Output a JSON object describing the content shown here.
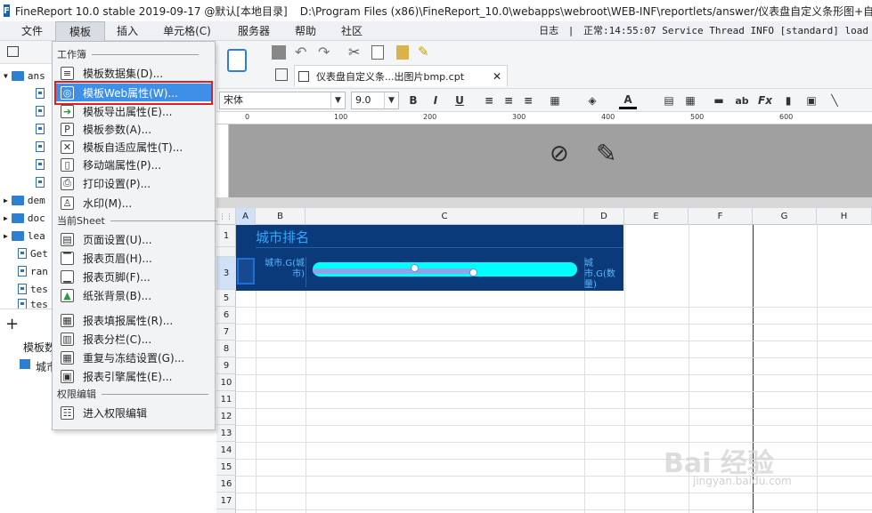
{
  "titlebar": {
    "app": "FineReport 10.0 stable 2019-09-17 @默认[本地目录]",
    "path": "D:\\Program Files (x86)\\FineReport_10.0\\webapps\\webroot\\WEB-INF\\reportlets/answer/仪表盘自定义条形图+自"
  },
  "menubar": {
    "items": [
      "文件",
      "模板",
      "插入",
      "单元格(C)",
      "服务器",
      "帮助",
      "社区"
    ],
    "log": "日志",
    "status": "正常:14:55:07 Service Thread INFO [standard] load"
  },
  "tree": {
    "items": [
      "ans",
      "",
      "",
      "",
      "",
      "",
      "",
      "",
      "dem",
      "doc",
      "lea",
      "Get",
      "ran",
      "tes",
      "tes"
    ]
  },
  "left_bottom": {
    "label1": "模板数",
    "label2": "城市"
  },
  "dropdown": {
    "sections": [
      "工作簿",
      "当前Sheet",
      "权限编辑"
    ],
    "items": [
      {
        "label": "模板数据集(D)...",
        "icon": "database-icon"
      },
      {
        "label": "模板Web属性(W)...",
        "icon": "globe-icon"
      },
      {
        "label": "模板导出属性(E)...",
        "icon": "export-icon"
      },
      {
        "label": "模板参数(A)...",
        "icon": "parameter-icon"
      },
      {
        "label": "模板自适应属性(T)...",
        "icon": "adaptive-icon"
      },
      {
        "label": "移动端属性(P)...",
        "icon": "mobile-icon"
      },
      {
        "label": "打印设置(P)...",
        "icon": "printer-icon"
      },
      {
        "label": "水印(M)...",
        "icon": "watermark-icon"
      },
      {
        "label": "页面设置(U)...",
        "icon": "page-setup-icon"
      },
      {
        "label": "报表页眉(H)...",
        "icon": "header-icon"
      },
      {
        "label": "报表页脚(F)...",
        "icon": "footer-icon"
      },
      {
        "label": "纸张背景(B)...",
        "icon": "background-icon"
      },
      {
        "label": "报表填报属性(R)...",
        "icon": "fill-report-icon"
      },
      {
        "label": "报表分栏(C)...",
        "icon": "columns-icon"
      },
      {
        "label": "重复与冻结设置(G)...",
        "icon": "freeze-icon"
      },
      {
        "label": "报表引擎属性(E)...",
        "icon": "engine-icon"
      },
      {
        "label": "进入权限编辑",
        "icon": "permission-icon"
      }
    ]
  },
  "doc_tab": {
    "label": "仪表盘自定义条...出图片bmp.cpt"
  },
  "format": {
    "font": "宋体",
    "size": "9.0"
  },
  "ruler": {
    "ticks": [
      "0",
      "100",
      "200",
      "300",
      "400",
      "500",
      "600"
    ]
  },
  "columns": [
    "A",
    "B",
    "C",
    "D",
    "E",
    "F",
    "G",
    "H"
  ],
  "rows": [
    "1",
    "3",
    "5",
    "6",
    "7",
    "8",
    "9",
    "10",
    "11",
    "12",
    "13",
    "14",
    "15",
    "16",
    "17"
  ],
  "report": {
    "title": "城市排名",
    "city_cell": "城市.G(城市)",
    "num_cell": "城市.G(数量)",
    "bar_value": 0.61
  },
  "watermark": {
    "text": "Bai 经验",
    "url": "jingyan.baidu.com"
  }
}
